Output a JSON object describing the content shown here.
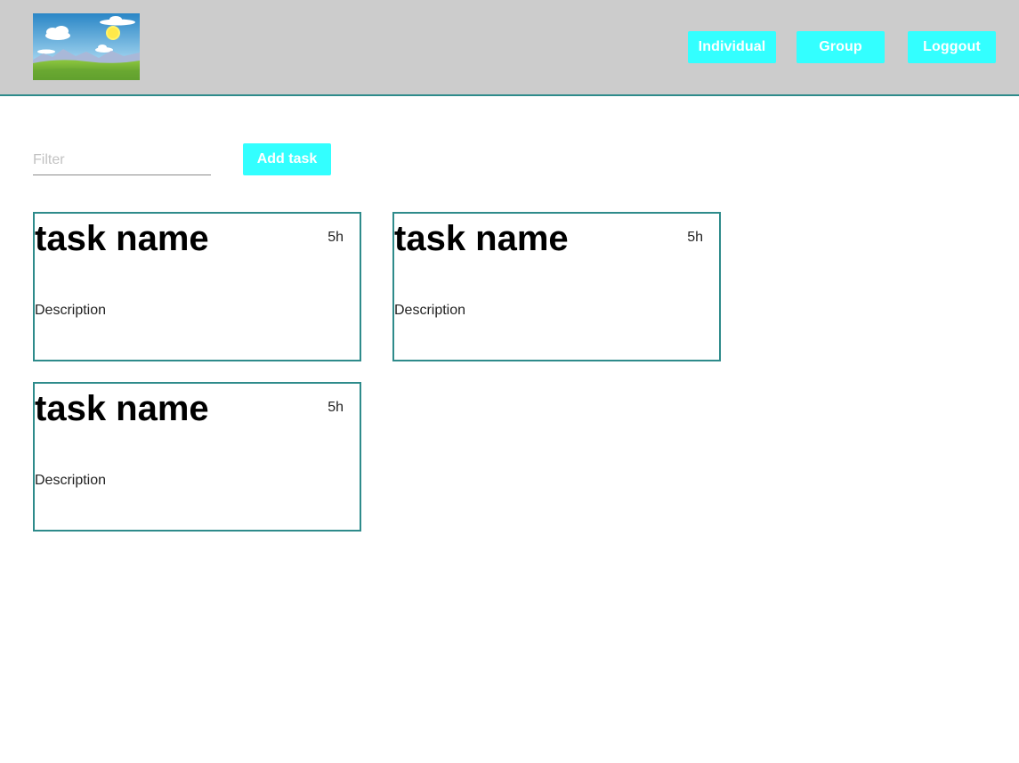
{
  "header": {
    "logo_icon": "landscape-logo-icon",
    "nav": {
      "individual_label": "Individual",
      "group_label": "Group",
      "logout_label": "Loggout"
    },
    "accent_color": "#33ffff",
    "border_color": "#2e8b8b",
    "background_color": "#cccccc"
  },
  "toolbar": {
    "filter_placeholder": "Filter",
    "filter_value": "",
    "add_task_label": "Add task"
  },
  "tasks": [
    {
      "name": "task name",
      "hours": "5h",
      "description": "Description"
    },
    {
      "name": "task name",
      "hours": "5h",
      "description": "Description"
    },
    {
      "name": "task name",
      "hours": "5h",
      "description": "Description"
    }
  ]
}
